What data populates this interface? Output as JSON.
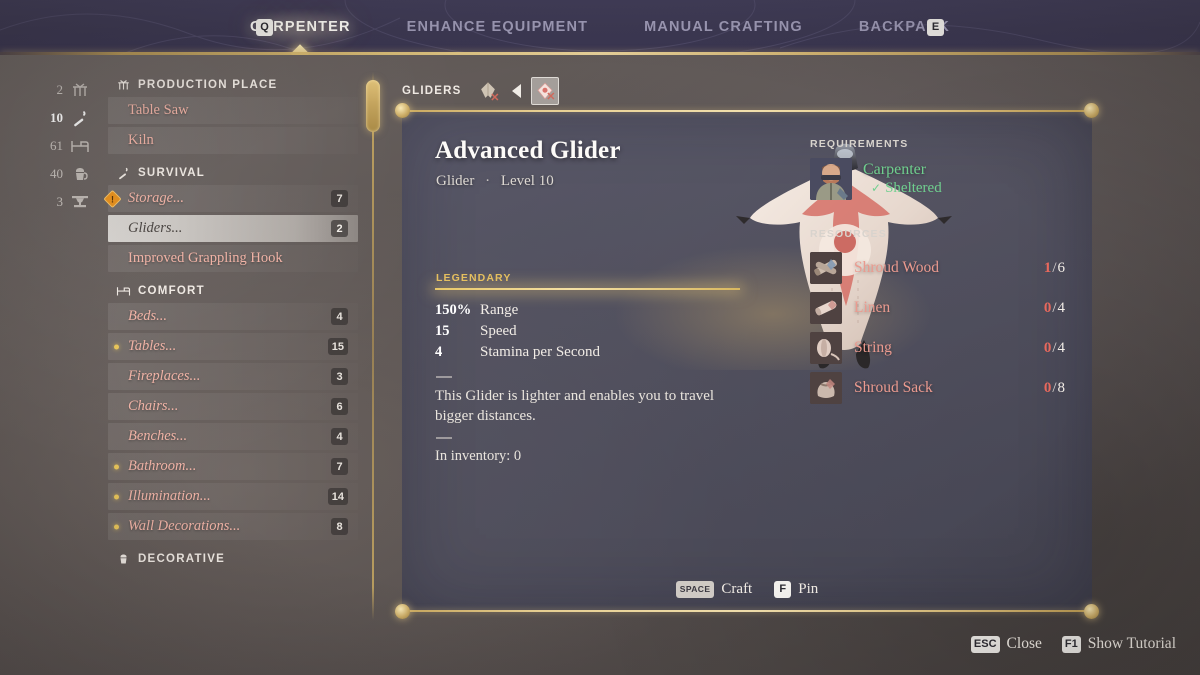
{
  "header": {
    "key_left": "Q",
    "key_right": "E",
    "tabs": [
      {
        "label": "CARPENTER",
        "active": true
      },
      {
        "label": "ENHANCE EQUIPMENT",
        "active": false
      },
      {
        "label": "MANUAL CRAFTING",
        "active": false
      },
      {
        "label": "BACKPACK",
        "active": false
      }
    ]
  },
  "rail": [
    {
      "count": "2",
      "icon": "workbench-icon",
      "bright": false
    },
    {
      "count": "10",
      "icon": "torch-icon",
      "bright": true
    },
    {
      "count": "61",
      "icon": "bed-icon",
      "bright": false
    },
    {
      "count": "40",
      "icon": "decor-icon",
      "bright": false
    },
    {
      "count": "3",
      "icon": "table-icon",
      "bright": false
    }
  ],
  "sidebar": {
    "groups": [
      {
        "title": "PRODUCTION PLACE",
        "icon": "workbench-icon",
        "items": [
          {
            "label": "Table Saw",
            "count": "",
            "selected": false,
            "italic": false,
            "bullet": false,
            "warn": false
          },
          {
            "label": "Kiln",
            "count": "",
            "selected": false,
            "italic": false,
            "bullet": false,
            "warn": false
          }
        ]
      },
      {
        "title": "SURVIVAL",
        "icon": "torch-icon",
        "items": [
          {
            "label": "Storage...",
            "count": "7",
            "selected": false,
            "italic": true,
            "bullet": false,
            "warn": true
          },
          {
            "label": "Gliders...",
            "count": "2",
            "selected": true,
            "italic": true,
            "bullet": false,
            "warn": false
          },
          {
            "label": "Improved Grappling Hook",
            "count": "",
            "selected": false,
            "italic": false,
            "bullet": false,
            "warn": false
          }
        ]
      },
      {
        "title": "COMFORT",
        "icon": "bed-icon",
        "items": [
          {
            "label": "Beds...",
            "count": "4",
            "selected": false,
            "italic": true,
            "bullet": false,
            "warn": false
          },
          {
            "label": "Tables...",
            "count": "15",
            "selected": false,
            "italic": true,
            "bullet": true,
            "warn": false
          },
          {
            "label": "Fireplaces...",
            "count": "3",
            "selected": false,
            "italic": true,
            "bullet": false,
            "warn": false
          },
          {
            "label": "Chairs...",
            "count": "6",
            "selected": false,
            "italic": true,
            "bullet": false,
            "warn": false
          },
          {
            "label": "Benches...",
            "count": "4",
            "selected": false,
            "italic": true,
            "bullet": false,
            "warn": false
          },
          {
            "label": "Bathroom...",
            "count": "7",
            "selected": false,
            "italic": true,
            "bullet": true,
            "warn": false
          },
          {
            "label": "Illumination...",
            "count": "14",
            "selected": false,
            "italic": true,
            "bullet": true,
            "warn": false
          },
          {
            "label": "Wall Decorations...",
            "count": "8",
            "selected": false,
            "italic": true,
            "bullet": true,
            "warn": false
          }
        ]
      },
      {
        "title": "DECORATIVE",
        "icon": "decor-icon",
        "items": []
      }
    ]
  },
  "breadcrumb": {
    "label": "GLIDERS",
    "items": [
      {
        "name": "basic-glider-icon",
        "selected": false,
        "unavailable": true
      },
      {
        "name": "advanced-glider-icon",
        "selected": true,
        "unavailable": true
      }
    ]
  },
  "item": {
    "name": "Advanced Glider",
    "type": "Glider",
    "separator": "·",
    "level": "Level 10",
    "rarity": "LEGENDARY",
    "art": "advanced-glider-art",
    "stats": [
      {
        "value": "150%",
        "label": "Range"
      },
      {
        "value": "15",
        "label": "Speed"
      },
      {
        "value": "4",
        "label": "Stamina per Second"
      }
    ],
    "description": "This Glider is lighter and enables you to travel bigger distances.",
    "inventory": "In inventory: 0"
  },
  "requirements": {
    "heading": "REQUIREMENTS",
    "job": "Carpenter",
    "condition": "Sheltered",
    "check_glyph": "✓",
    "avatar": "carpenter-avatar"
  },
  "resources": {
    "heading": "RESOURCES",
    "items": [
      {
        "name": "Shroud Wood",
        "have": "1",
        "need": "6",
        "icon": "shroud-wood-icon"
      },
      {
        "name": "Linen",
        "have": "0",
        "need": "4",
        "icon": "linen-icon"
      },
      {
        "name": "String",
        "have": "0",
        "need": "4",
        "icon": "string-icon"
      },
      {
        "name": "Shroud Sack",
        "have": "0",
        "need": "8",
        "icon": "shroud-sack-icon"
      }
    ]
  },
  "panel_actions": [
    {
      "key": "SPACE",
      "label": "Craft"
    },
    {
      "key": "F",
      "label": "Pin"
    }
  ],
  "footer_actions": [
    {
      "key": "ESC",
      "label": "Close"
    },
    {
      "key": "F1",
      "label": "Show Tutorial"
    }
  ],
  "colors": {
    "gold": "#e0c078",
    "header_navy": "#3c3852",
    "rarity_legendary": "#e5bf5e",
    "requirement_met": "#6fcf8e",
    "resource_missing": "#e8685c",
    "item_label": "#f0b3a6"
  }
}
